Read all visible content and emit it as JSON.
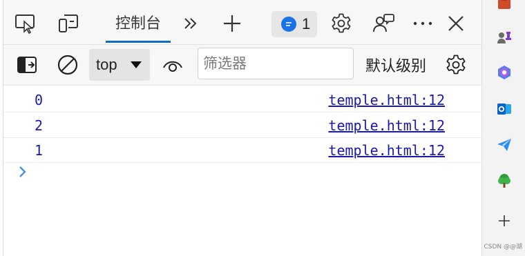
{
  "tabs": {
    "console_label": "控制台",
    "issues_count": "1"
  },
  "toolbar": {
    "context_value": "top",
    "filter_placeholder": "筛选器",
    "levels_label": "默认级别"
  },
  "logs": [
    {
      "value": "0",
      "source": "temple.html:12"
    },
    {
      "value": "2",
      "source": "temple.html:12"
    },
    {
      "value": "1",
      "source": "temple.html:12"
    }
  ],
  "watermark": "CSDN @@湖",
  "icons": {
    "tabbar": [
      "inspect-element-icon",
      "device-emulation-icon",
      "more-tabs-icon",
      "add-tab-icon",
      "issues-chat-icon",
      "settings-icon",
      "feedback-icon",
      "more-options-icon",
      "close-icon"
    ],
    "toolbar": [
      "toggle-sidebar-icon",
      "clear-console-icon",
      "live-expression-eye-icon",
      "console-settings-icon"
    ],
    "sidebar": [
      "toolbox-icon",
      "games-icon",
      "copilot-icon",
      "outlook-icon",
      "telegram-icon",
      "tree-icon",
      "add-icon"
    ]
  },
  "colors": {
    "accent": "#0f6cbd",
    "log_text": "#1a1aa6",
    "issues_blue": "#1a73e8"
  }
}
